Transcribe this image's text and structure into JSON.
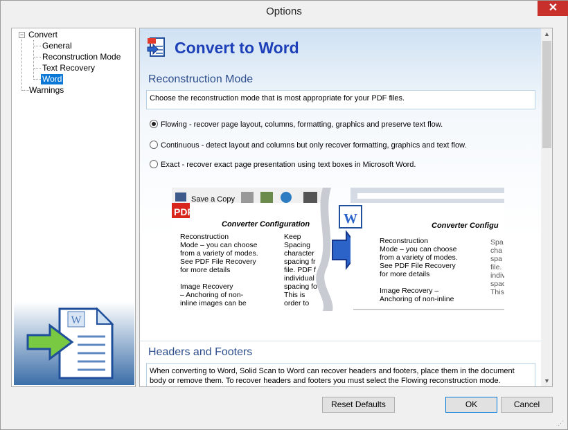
{
  "window": {
    "title": "Options",
    "close_label": "✕"
  },
  "tree": {
    "root": "Convert",
    "children": [
      "General",
      "Reconstruction Mode",
      "Text Recovery",
      "Word"
    ],
    "selected": "Word",
    "sibling": "Warnings"
  },
  "content": {
    "page_title": "Convert to Word",
    "reconstruction": {
      "title": "Reconstruction Mode",
      "description": "Choose the reconstruction mode that is most appropriate for your PDF files.",
      "options": [
        {
          "label": "Flowing - recover page layout, columns, formatting, graphics and preserve text flow.",
          "selected": true
        },
        {
          "label": "Continuous - detect layout and columns but only recover formatting, graphics and text flow.",
          "selected": false
        },
        {
          "label": "Exact - recover exact page presentation using text boxes in Microsoft Word.",
          "selected": false
        }
      ]
    },
    "illustration": {
      "toolbar_text": "Save a Copy",
      "pdf_badge": "PDF",
      "word_badge": "W",
      "heading": "Converter Configuration",
      "left_col1": [
        "Reconstruction",
        "Mode – you can choose",
        "from a variety of modes.",
        "See PDF File Recovery",
        "for more details",
        "",
        "Image Recovery",
        "– Anchoring of non-",
        "inline images can be"
      ],
      "left_col2": [
        "Keep",
        "Spacing",
        "character",
        "spacing fr",
        "file. PDF f",
        "individual",
        "spacing fo",
        "This is",
        "order to"
      ],
      "right_heading": "Converter Configu",
      "right_col1": [
        "Reconstruction",
        "Mode – you can choose",
        "from a variety of modes.",
        "See PDF File Recovery",
        "for more details",
        "",
        "Image Recovery –",
        "Anchoring of non-inline"
      ],
      "right_col2": [
        "Spa",
        "cha",
        "spa",
        "file.",
        "indiv",
        "spac",
        "This"
      ]
    },
    "headers": {
      "title": "Headers and Footers",
      "description": "When converting to Word, Solid Scan to Word can recover headers and footers, place them in the document body or remove them. To recover headers and footers you must select the Flowing reconstruction mode."
    }
  },
  "buttons": {
    "reset": "Reset Defaults",
    "ok": "OK",
    "cancel": "Cancel"
  },
  "scrollbar": {
    "up": "▲",
    "down": "▼"
  },
  "colors": {
    "accent": "#1d3fb7",
    "selection": "#0a78d7",
    "close": "#c7302b"
  }
}
